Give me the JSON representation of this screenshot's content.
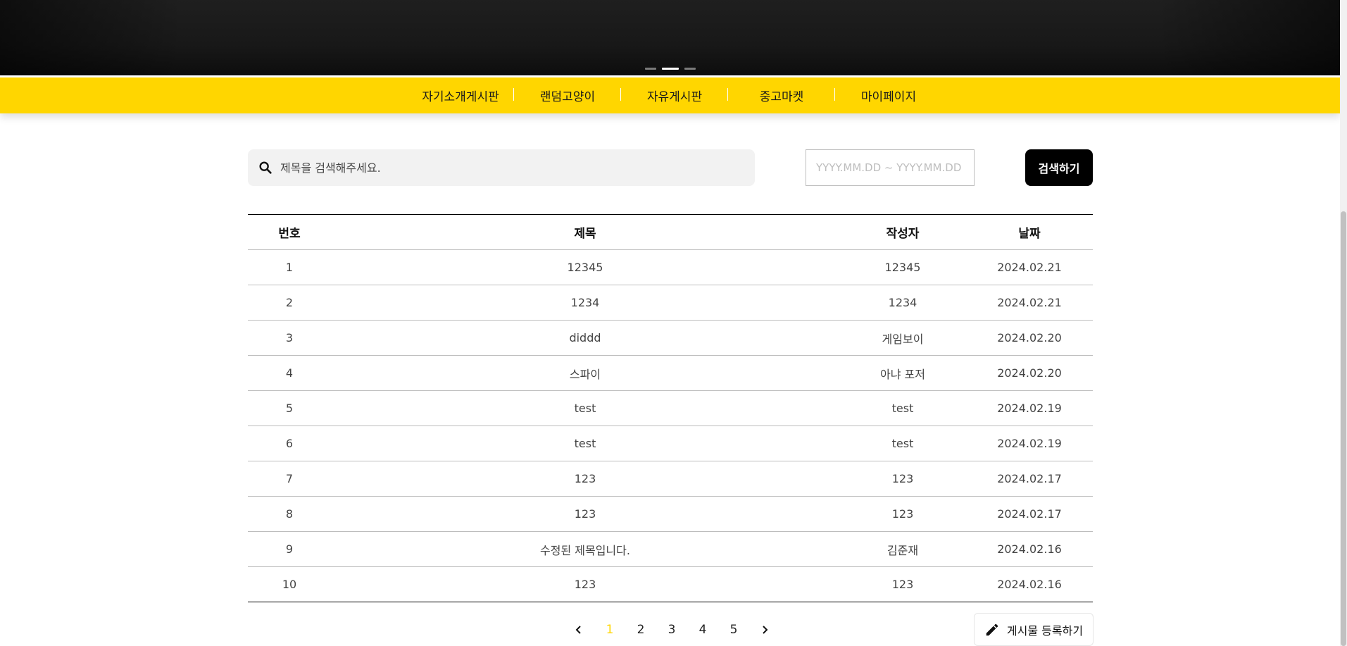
{
  "banner": {
    "slide_count": 3,
    "active_slide": 2
  },
  "nav": {
    "items": [
      "자기소개게시판",
      "랜덤고양이",
      "자유게시판",
      "중고마켓",
      "마이페이지"
    ]
  },
  "search": {
    "placeholder": "제목을 검색해주세요.",
    "date_placeholder": "YYYY.MM.DD ~ YYYY.MM.DD",
    "button_label": "검색하기"
  },
  "table": {
    "headers": {
      "no": "번호",
      "title": "제목",
      "writer": "작성자",
      "date": "날짜"
    },
    "rows": [
      {
        "no": "1",
        "title": "12345",
        "writer": "12345",
        "date": "2024.02.21"
      },
      {
        "no": "2",
        "title": "1234",
        "writer": "1234",
        "date": "2024.02.21"
      },
      {
        "no": "3",
        "title": "diddd",
        "writer": "게임보이",
        "date": "2024.02.20"
      },
      {
        "no": "4",
        "title": "스파이",
        "writer": "아냐 포저",
        "date": "2024.02.20"
      },
      {
        "no": "5",
        "title": "test",
        "writer": "test",
        "date": "2024.02.19"
      },
      {
        "no": "6",
        "title": "test",
        "writer": "test",
        "date": "2024.02.19"
      },
      {
        "no": "7",
        "title": "123",
        "writer": "123",
        "date": "2024.02.17"
      },
      {
        "no": "8",
        "title": "123",
        "writer": "123",
        "date": "2024.02.17"
      },
      {
        "no": "9",
        "title": "수정된 제목입니다.",
        "writer": "김준재",
        "date": "2024.02.16"
      },
      {
        "no": "10",
        "title": "123",
        "writer": "123",
        "date": "2024.02.16"
      }
    ]
  },
  "pagination": {
    "pages": [
      "1",
      "2",
      "3",
      "4",
      "5"
    ],
    "current": "1",
    "active_color": "#ffd600"
  },
  "write_button": {
    "label": "게시물 등록하기",
    "icon": "pencil-icon"
  },
  "colors": {
    "accent": "#ffd600",
    "button_dark": "#000000"
  }
}
